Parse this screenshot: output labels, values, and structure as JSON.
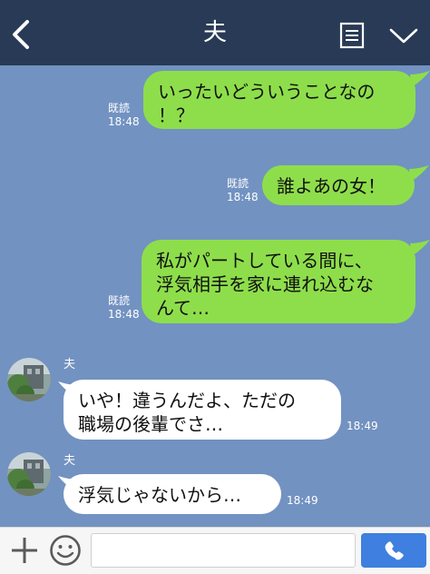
{
  "header": {
    "title": "夫",
    "icons": {
      "back": "chevron-left-icon",
      "note": "note-icon",
      "menu": "chevron-down-icon"
    }
  },
  "messages": [
    {
      "direction": "out",
      "text_lines": [
        "いったいどういうことなの",
        "！？"
      ],
      "read": "既読",
      "time": "18:48"
    },
    {
      "direction": "out",
      "text_lines": [
        "誰よあの女！"
      ],
      "read": "既読",
      "time": "18:48"
    },
    {
      "direction": "out",
      "text_lines": [
        "私がパートしている間に、",
        "浮気相手を家に連れ込むな",
        "んて…"
      ],
      "read": "既読",
      "time": "18:48"
    },
    {
      "direction": "in",
      "sender": "夫",
      "text_lines": [
        "いや！違うんだよ、ただの",
        "職場の後輩でさ…"
      ],
      "time": "18:49"
    },
    {
      "direction": "in",
      "sender": "夫",
      "text_lines": [
        "浮気じゃないから…"
      ],
      "time": "18:49"
    }
  ],
  "footer": {
    "input_placeholder": "",
    "input_value": "",
    "icons": {
      "add": "plus-icon",
      "sticker": "smile-icon",
      "call": "phone-icon"
    }
  },
  "colors": {
    "header_bg": "#283a55",
    "chat_bg": "#7292c1",
    "out_bubble": "#8ede4b",
    "in_bubble": "#ffffff",
    "call_button": "#3e7fe0"
  }
}
